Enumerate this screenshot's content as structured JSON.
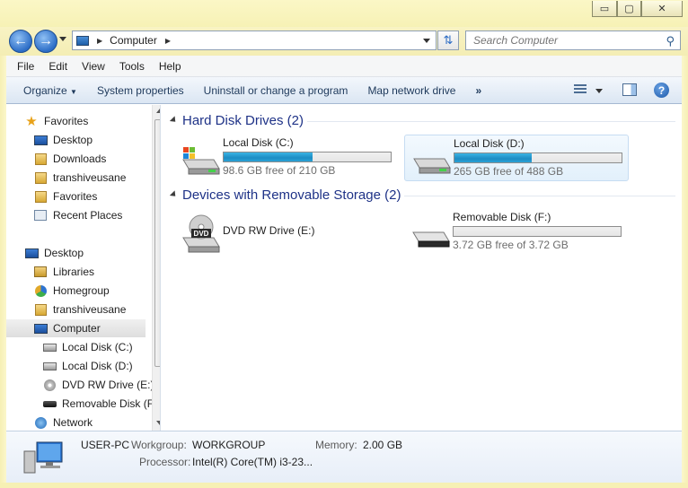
{
  "window": {
    "minimize_glyph": "▭",
    "maximize_glyph": "▢",
    "close_glyph": "✕"
  },
  "address": {
    "location": "Computer",
    "search_placeholder": "Search Computer"
  },
  "menu": [
    "File",
    "Edit",
    "View",
    "Tools",
    "Help"
  ],
  "commands": {
    "organize": "Organize",
    "system_properties": "System properties",
    "uninstall": "Uninstall or change a program",
    "map_network_drive": "Map network drive",
    "more": "»"
  },
  "nav": {
    "favorites": "Favorites",
    "fav_desktop": "Desktop",
    "fav_downloads": "Downloads",
    "fav_user": "transhiveusane",
    "fav_favorites": "Favorites",
    "fav_recent": "Recent Places",
    "desktop": "Desktop",
    "libraries": "Libraries",
    "homegroup": "Homegroup",
    "user": "transhiveusane",
    "computer": "Computer",
    "disk_c": "Local Disk (C:)",
    "disk_d": "Local Disk (D:)",
    "dvd": "DVD RW Drive (E:)",
    "removable": "Removable Disk (F:)",
    "network": "Network"
  },
  "groups": {
    "hard_disks": "Hard Disk Drives (2)",
    "removable": "Devices with Removable Storage (2)"
  },
  "drives": {
    "c": {
      "name": "Local Disk (C:)",
      "free": "98.6 GB free of 210 GB",
      "used_fraction": 0.53
    },
    "d": {
      "name": "Local Disk (D:)",
      "free": "265 GB free of 488 GB",
      "used_fraction": 0.46
    },
    "e": {
      "name": "DVD RW Drive (E:)",
      "dvd_label": "DVD"
    },
    "f": {
      "name": "Removable Disk (F:)",
      "free": "3.72 GB free of 3.72 GB",
      "used_fraction": 0.0
    }
  },
  "details": {
    "pc_name": "USER-PC",
    "workgroup_label": "Workgroup:",
    "workgroup_value": "WORKGROUP",
    "memory_label": "Memory:",
    "memory_value": "2.00 GB",
    "processor_label": "Processor:",
    "processor_value": "Intel(R) Core(TM) i3-23..."
  },
  "colors": {
    "header_blue": "#1e3287",
    "bar_fill": "#1d8cc3",
    "title_bg": "#f6f1b4"
  }
}
